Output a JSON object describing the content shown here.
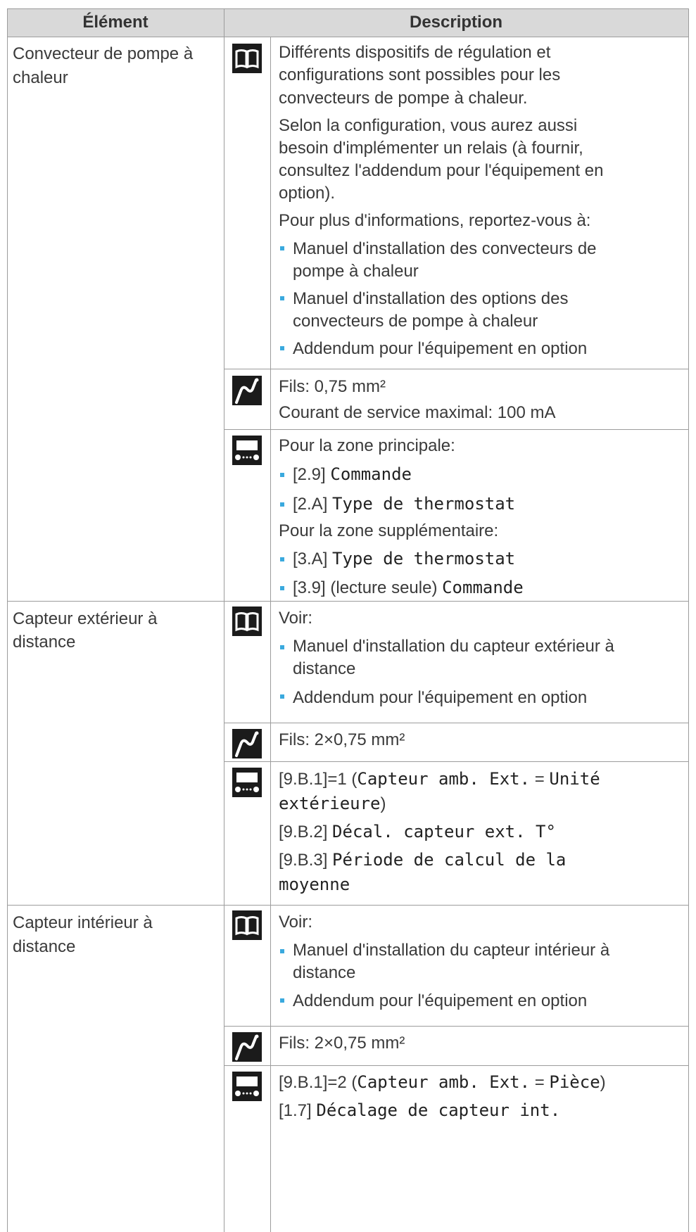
{
  "header": {
    "element": "Élément",
    "description": "Description"
  },
  "row1": {
    "element": [
      "Convecteur de pompe à",
      "chaleur"
    ],
    "book": {
      "p1": [
        "Différents dispositifs de régulation et",
        "configurations sont possibles pour les",
        "convecteurs de pompe à chaleur."
      ],
      "p2": [
        "Selon la configuration, vous aurez aussi",
        "besoin d'implémenter un relais (à fournir,",
        "consultez l'addendum pour l'équipement en",
        "option)."
      ],
      "p3": "Pour plus d'informations, reportez-vous à:",
      "b1": [
        "Manuel d'installation des convecteurs de",
        "pompe à chaleur"
      ],
      "b2": [
        "Manuel d'installation des options des",
        "convecteurs de pompe à chaleur"
      ],
      "b3": "Addendum pour l'équipement en option"
    },
    "wire": {
      "l1": "Fils: 0,75 mm²",
      "l2": "Courant de service maximal: 100 mA"
    },
    "ui": {
      "p1": "Pour la zone principale:",
      "b1_code": "[2.9]",
      "b1_name": "Commande",
      "b2_code": "[2.A]",
      "b2_name": "Type de thermostat",
      "p2": "Pour la zone supplémentaire:",
      "b3_code": "[3.A]",
      "b3_name": "Type de thermostat",
      "b4_code": "[3.9] (lecture seule)",
      "b4_name": "Commande"
    }
  },
  "row2": {
    "element": [
      "Capteur extérieur à",
      "distance"
    ],
    "book": {
      "p1": "Voir:",
      "b1": [
        "Manuel d'installation du capteur extérieur à",
        "distance"
      ],
      "b2": "Addendum pour l'équipement en option"
    },
    "wire": {
      "l1": "Fils: 2×0,75 mm²"
    },
    "ui": {
      "l1_code": "[9.B.1]=1 (",
      "l1_name": "Capteur amb. Ext.",
      "l1_eq": " = ",
      "l1_val": "Unité",
      "l2_val": "extérieure",
      "l2_close": ")",
      "l3_code": "[9.B.2]",
      "l3_name": "Décal. capteur ext. T°",
      "l4_code": "[9.B.3]",
      "l4_name": "Période de calcul de la",
      "l5_name": "moyenne"
    }
  },
  "row3": {
    "element": [
      "Capteur intérieur à",
      "distance"
    ],
    "book": {
      "p1": "Voir:",
      "b1": [
        "Manuel d'installation du capteur intérieur à",
        "distance"
      ],
      "b2": "Addendum pour l'équipement en option"
    },
    "wire": {
      "l1": "Fils: 2×0,75 mm²"
    },
    "ui": {
      "l1_code": "[9.B.1]=2 (",
      "l1_name": "Capteur amb. Ext.",
      "l1_eq": " = ",
      "l1_val": "Pièce",
      "l1_close": ")",
      "l2_code": "[1.7]",
      "l2_name": "Décalage de capteur int."
    }
  },
  "icons": {
    "book": "book-icon",
    "wire": "wire-icon",
    "ui": "user-interface-icon"
  }
}
